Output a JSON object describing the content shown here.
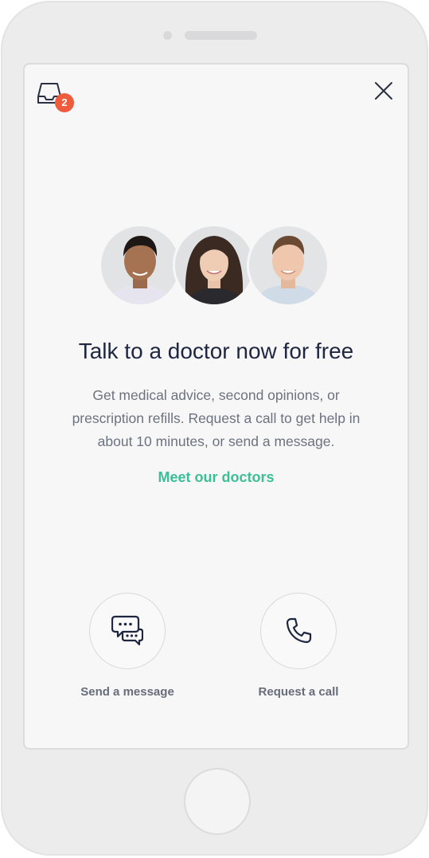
{
  "notifications": {
    "count": "2"
  },
  "hero": {
    "title": "Talk to a doctor now for free",
    "description": "Get medical advice, second opinions, or prescription refills. Request a call to get help in about 10 minutes, or send a message.",
    "meet_link": "Meet our doctors"
  },
  "actions": {
    "message_label": "Send a message",
    "call_label": "Request a call"
  },
  "colors": {
    "accent": "#3dbf96",
    "badge": "#ef5b3d",
    "heading": "#1f2640",
    "body_text": "#6d7280"
  },
  "icons": {
    "inbox": "inbox-icon",
    "close": "close-icon",
    "message": "chat-bubbles-icon",
    "call": "phone-icon"
  }
}
